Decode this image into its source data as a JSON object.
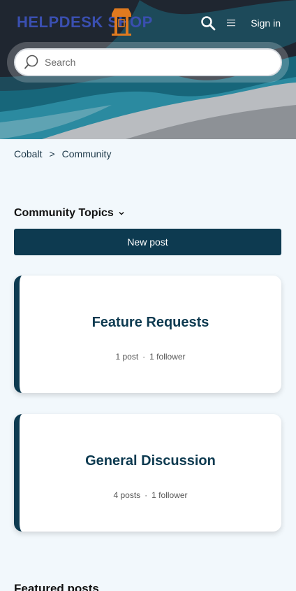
{
  "header": {
    "logo_text": "HELPDESK SHOP",
    "sign_in": "Sign in",
    "search_icon": "search-icon",
    "menu_icon": "hamburger-menu-icon"
  },
  "search": {
    "placeholder": "Search"
  },
  "breadcrumb": {
    "items": [
      "Cobalt",
      "Community"
    ],
    "separator": ">"
  },
  "topics": {
    "title": "Community Topics",
    "new_post": "New post",
    "cards": [
      {
        "title": "Feature Requests",
        "posts": "1 post",
        "followers": "1 follower"
      },
      {
        "title": "General Discussion",
        "posts": "4 posts",
        "followers": "1 follower"
      }
    ]
  },
  "featured": {
    "title": "Featured posts"
  },
  "colors": {
    "brand_dark": "#0d3a50",
    "logo_blue": "#3a4fb0",
    "logo_orange": "#e07a1f"
  }
}
